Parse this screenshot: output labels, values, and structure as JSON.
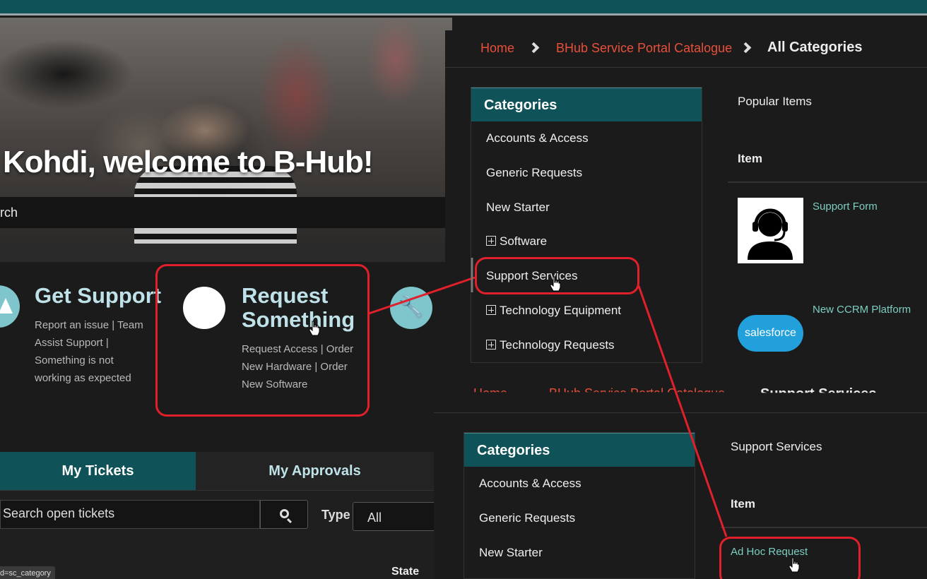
{
  "hero": {
    "title": "Kohdi, welcome to B-Hub!",
    "search_text": "rch"
  },
  "cards": {
    "get_support": {
      "title": "Get Support",
      "line1": "Report an issue | Team",
      "line2": "Assist Support |",
      "line3": "Something is not",
      "line4": "working as expected"
    },
    "request_something": {
      "title1": "Request",
      "title2": "Something",
      "line1": "Request Access | Order",
      "line2": "New Hardware | Order",
      "line3": "New Software"
    },
    "wrench_icon": "wrench-icon"
  },
  "tickets": {
    "tab_my_tickets": "My Tickets",
    "tab_my_approvals": "My Approvals",
    "search_placeholder": "Search open tickets",
    "type_label": "Type",
    "type_value": "All",
    "state_header": "State",
    "tooltip": "d=sc_category"
  },
  "catalog_top": {
    "breadcrumb": [
      "Home",
      "BHub Service Portal Catalogue",
      "All Categories"
    ],
    "categories_title": "Categories",
    "categories": [
      "Accounts & Access",
      "Generic Requests",
      "New Starter",
      "Software",
      "Support Services",
      "Technology Equipment",
      "Technology Requests"
    ],
    "popular_title": "Popular Items",
    "item_header": "Item",
    "items": [
      "Support Form",
      "New CCRM Platform"
    ],
    "salesforce_logo_text": "salesforce"
  },
  "catalog_bottom": {
    "breadcrumb": [
      "Home",
      "BHub Service Portal Catalogue",
      "Support Services"
    ],
    "categories_title": "Categories",
    "categories": [
      "Accounts & Access",
      "Generic Requests",
      "New Starter"
    ],
    "section_title": "Support Services",
    "item_header": "Item",
    "items": [
      "Ad Hoc Request"
    ]
  },
  "colors": {
    "teal": "#0f5257",
    "light_teal": "#7fc5cc",
    "link_red": "#e8503a",
    "item_link": "#7ccfc0",
    "annotation_red": "#e0202a"
  }
}
